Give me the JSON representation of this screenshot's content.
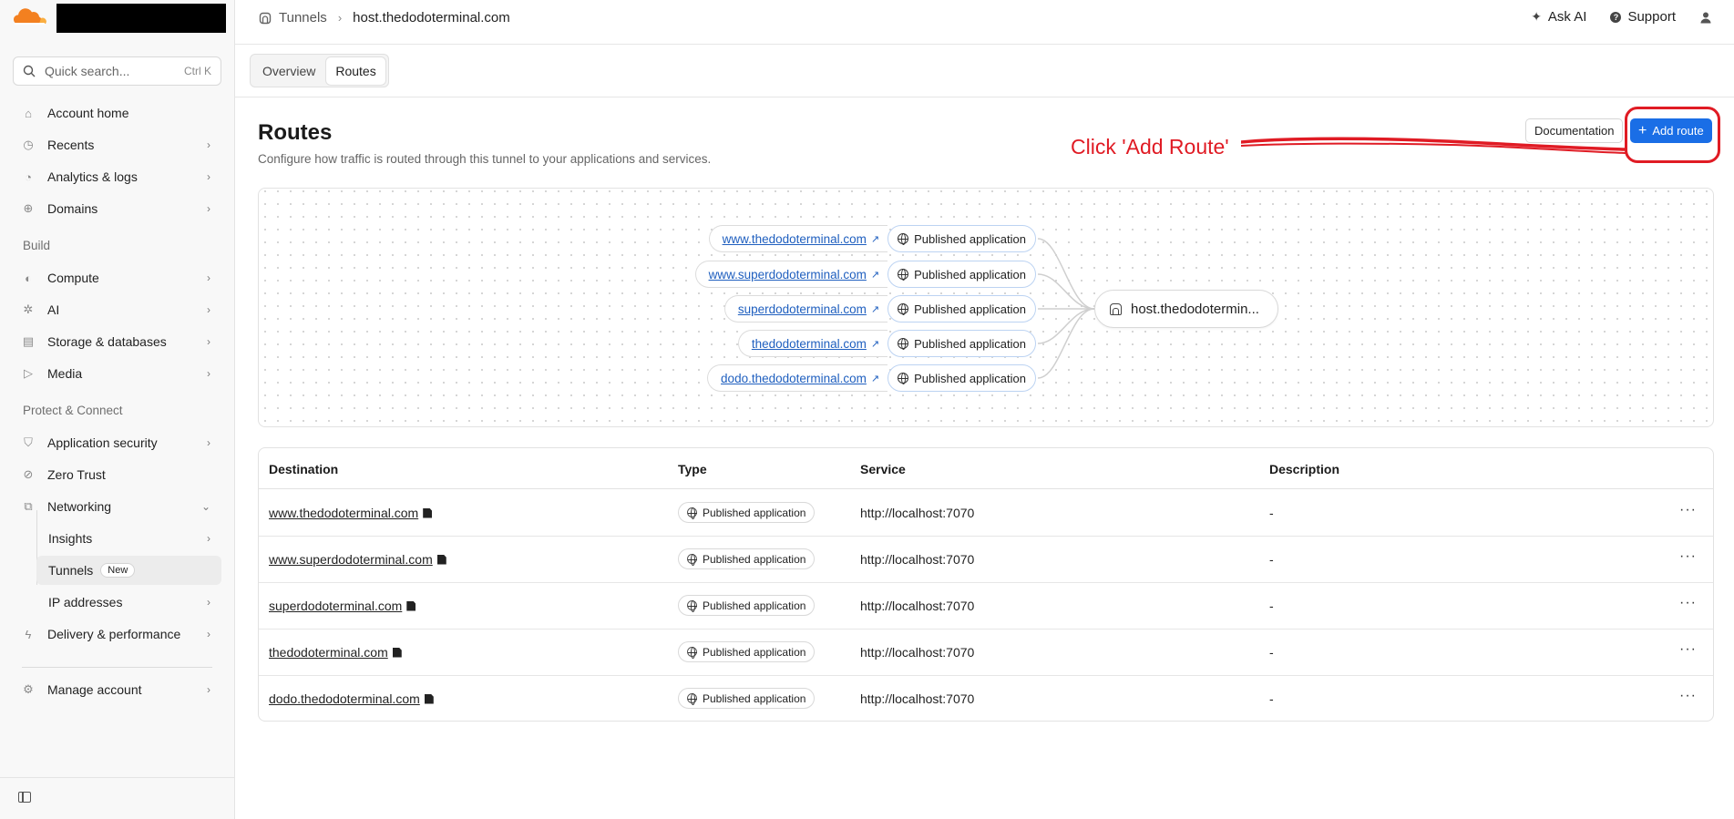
{
  "sidebar": {
    "search": {
      "placeholder": "Quick search...",
      "shortcut": "Ctrl K"
    },
    "items": [
      {
        "label": "Account home",
        "icon": "home-icon"
      },
      {
        "label": "Recents",
        "icon": "clock-icon"
      },
      {
        "label": "Analytics & logs",
        "icon": "chart-icon"
      },
      {
        "label": "Domains",
        "icon": "globe-icon"
      }
    ],
    "build_label": "Build",
    "build_items": [
      {
        "label": "Compute",
        "icon": "compute-icon"
      },
      {
        "label": "AI",
        "icon": "sparkle-icon"
      },
      {
        "label": "Storage & databases",
        "icon": "storage-icon"
      },
      {
        "label": "Media",
        "icon": "media-icon"
      }
    ],
    "protect_label": "Protect & Connect",
    "protect_items": [
      {
        "label": "Application security",
        "icon": "shield-icon"
      },
      {
        "label": "Zero Trust",
        "icon": "zero-trust-icon"
      },
      {
        "label": "Networking",
        "icon": "network-icon"
      }
    ],
    "networking_sub": [
      {
        "label": "Insights"
      },
      {
        "label": "Tunnels",
        "badge": "New"
      },
      {
        "label": "IP addresses"
      }
    ],
    "delivery": {
      "label": "Delivery & performance",
      "icon": "bolt-icon"
    },
    "manage": {
      "label": "Manage account",
      "icon": "gear-icon"
    }
  },
  "topbar": {
    "breadcrumb_parent": "Tunnels",
    "breadcrumb_current": "host.thedodoterminal.com",
    "ask_ai": "Ask AI",
    "support": "Support"
  },
  "tabs": [
    {
      "label": "Overview"
    },
    {
      "label": "Routes"
    }
  ],
  "page": {
    "title": "Routes",
    "description": "Configure how traffic is routed through this tunnel to your applications and services.",
    "documentation_label": "Documentation",
    "add_route_label": "Add route",
    "annotation": "Click 'Add Route'"
  },
  "diagram": {
    "routes": [
      {
        "destination": "www.thedodoterminal.com",
        "type": "Published application"
      },
      {
        "destination": "www.superdodoterminal.com",
        "type": "Published application"
      },
      {
        "destination": "superdodoterminal.com",
        "type": "Published application"
      },
      {
        "destination": "thedodoterminal.com",
        "type": "Published application"
      },
      {
        "destination": "dodo.thedodoterminal.com",
        "type": "Published application"
      }
    ],
    "host": "host.thedodotermin..."
  },
  "table": {
    "headers": {
      "destination": "Destination",
      "type": "Type",
      "service": "Service",
      "description": "Description"
    },
    "rows": [
      {
        "destination": "www.thedodoterminal.com",
        "type": "Published application",
        "service": "http://localhost:7070",
        "description": "-"
      },
      {
        "destination": "www.superdodoterminal.com",
        "type": "Published application",
        "service": "http://localhost:7070",
        "description": "-"
      },
      {
        "destination": "superdodoterminal.com",
        "type": "Published application",
        "service": "http://localhost:7070",
        "description": "-"
      },
      {
        "destination": "thedodoterminal.com",
        "type": "Published application",
        "service": "http://localhost:7070",
        "description": "-"
      },
      {
        "destination": "dodo.thedodoterminal.com",
        "type": "Published application",
        "service": "http://localhost:7070",
        "description": "-"
      }
    ]
  },
  "colors": {
    "accent": "#1a6ee6",
    "annotation": "#e01b24",
    "link": "#1f5fbf"
  }
}
